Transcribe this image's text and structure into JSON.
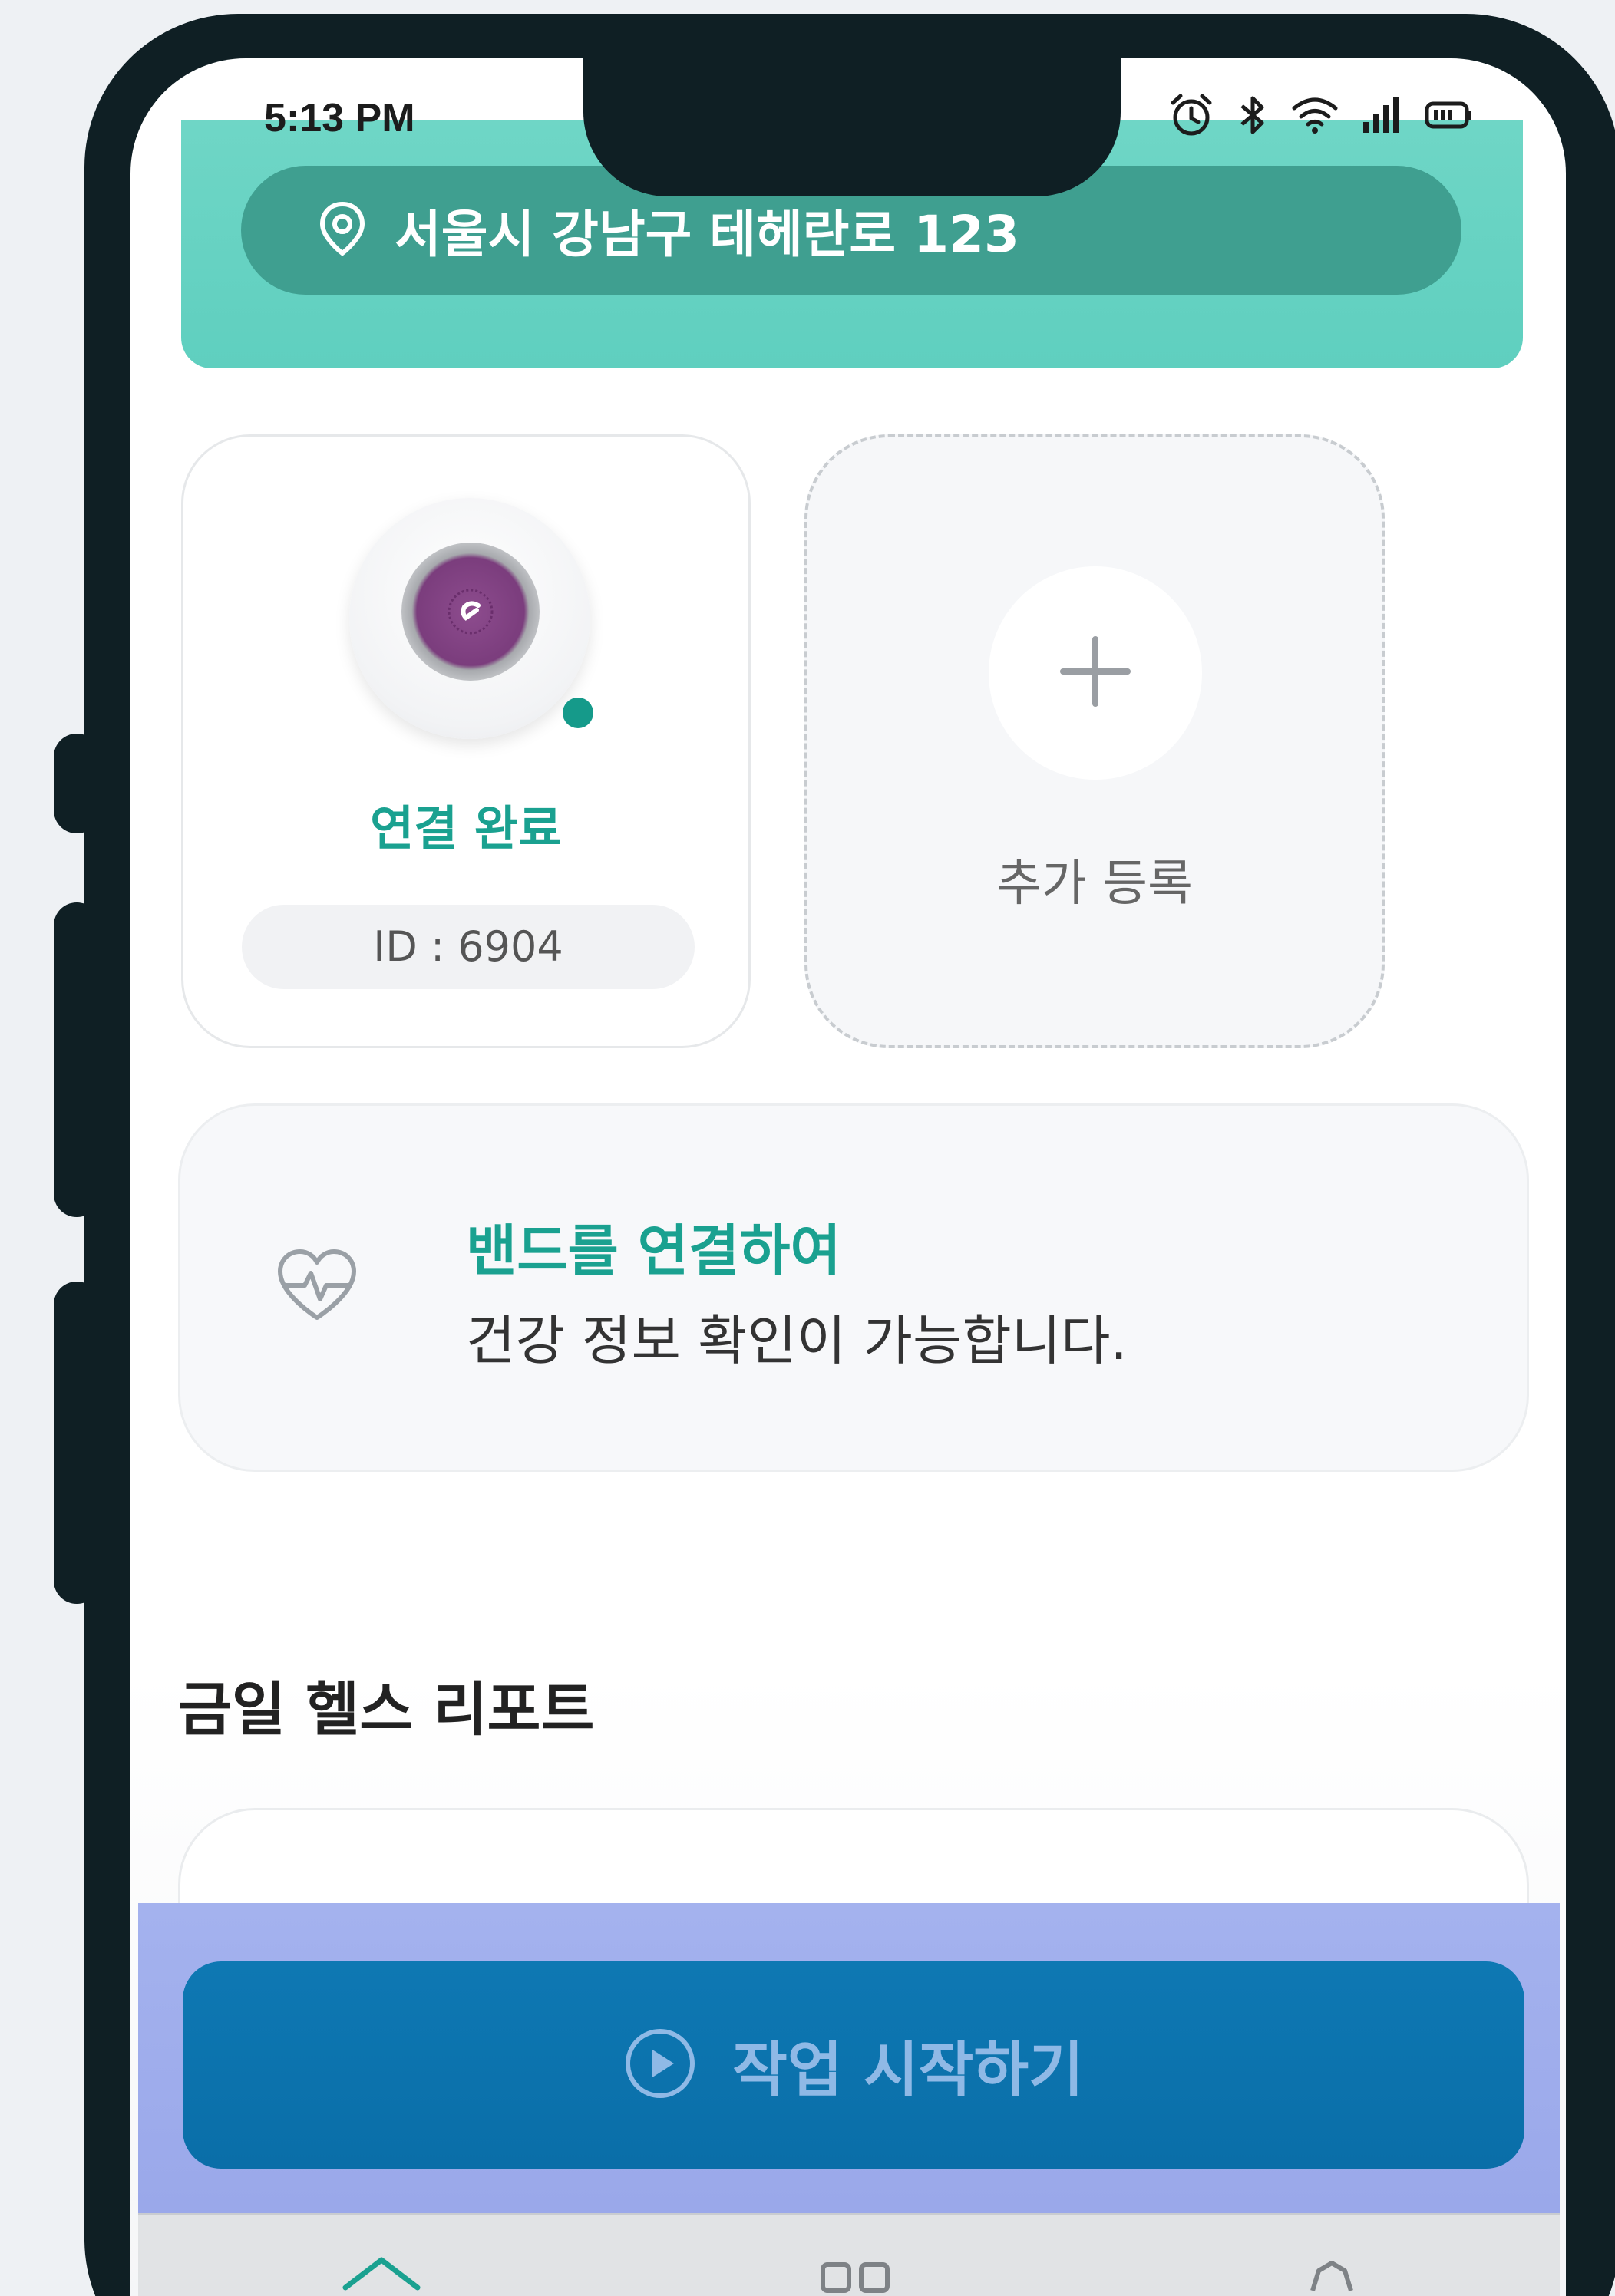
{
  "status_bar": {
    "time": "5:13 PM",
    "icons": [
      "alarm-icon",
      "bluetooth-icon",
      "wifi-icon",
      "signal-icon",
      "battery-icon"
    ]
  },
  "header": {
    "address": "서울시 강남구 테헤란로 123",
    "icon": "location-pin-icon",
    "accent_color": "#5fcfbf"
  },
  "device_card": {
    "status": "연결 완료",
    "id_label": "ID : 6904",
    "status_color": "#1aa190"
  },
  "add_card": {
    "label": "추가 등록",
    "icon": "plus-icon"
  },
  "band_info": {
    "title": "밴드를 연결하여",
    "subtitle": "건강 정보 확인이 가능합니다.",
    "icon": "heart-pulse-icon"
  },
  "report": {
    "title": "금일 헬스 리포트"
  },
  "start_button": {
    "label": "작업 시작하기",
    "icon": "play-circle-icon",
    "color": "#0e78b3"
  },
  "bottom_nav": {
    "items": [
      "home-icon",
      "grid-icon",
      "settings-icon"
    ]
  }
}
